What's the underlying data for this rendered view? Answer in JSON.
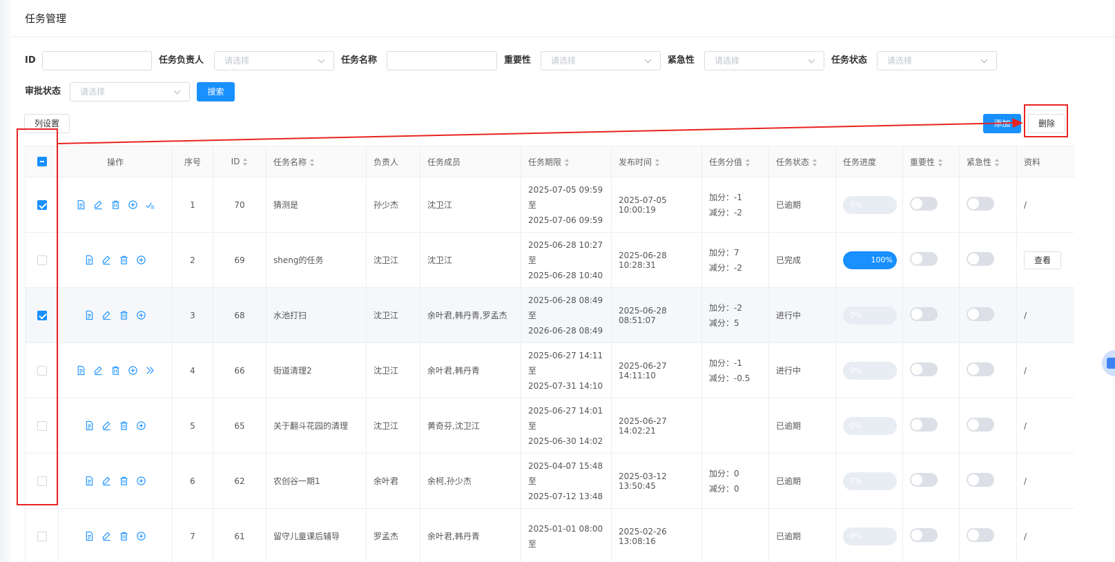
{
  "header": {
    "title": "任务管理"
  },
  "filters": {
    "id_label": "ID",
    "owner_label": "任务负责人",
    "owner_placeholder": "请选择",
    "name_label": "任务名称",
    "importance_label": "重要性",
    "importance_placeholder": "请选择",
    "urgency_label": "紧急性",
    "urgency_placeholder": "请选择",
    "status_label": "任务状态",
    "status_placeholder": "请选择",
    "approval_label": "审批状态",
    "approval_placeholder": "请选择",
    "search_button": "搜索"
  },
  "toolbar": {
    "column_settings": "列设置",
    "add_button": "添加",
    "delete_button": "删除"
  },
  "table": {
    "columns": {
      "ops": "操作",
      "seq": "序号",
      "id": "ID",
      "name": "任务名称",
      "owner": "负责人",
      "members": "任务成员",
      "deadline": "任务期限",
      "publish": "发布时间",
      "score": "任务分值",
      "status": "任务状态",
      "progress": "任务进度",
      "importance": "重要性",
      "urgency": "紧急性",
      "material": "资料"
    },
    "to_label": "至",
    "rows": [
      {
        "checked": true,
        "seq": "1",
        "id": "70",
        "name": "猜测是",
        "owner": "孙少杰",
        "members": "沈卫江",
        "start": "2025-07-05 09:59",
        "end": "2025-07-06 09:59",
        "publish": "2025-07-05 10:00:19",
        "plus": "加分：-1",
        "minus": "减分：-2",
        "status": "已逾期",
        "progress_pct": 0,
        "progress_text": "0%",
        "material": "/",
        "extra_icon": "approve-icon"
      },
      {
        "checked": false,
        "seq": "2",
        "id": "69",
        "name": "sheng的任务",
        "owner": "沈卫江",
        "members": "沈卫江",
        "start": "2025-06-28 10:27",
        "end": "2025-06-28 10:40",
        "publish": "2025-06-28 10:28:31",
        "plus": "加分：7",
        "minus": "减分：-2",
        "status": "已完成",
        "progress_pct": 100,
        "progress_text": "100%",
        "material": "查看",
        "extra_icon": ""
      },
      {
        "checked": true,
        "seq": "3",
        "id": "68",
        "name": "水池打扫",
        "owner": "沈卫江",
        "members": "余叶君,韩丹青,罗孟杰",
        "start": "2025-06-28 08:49",
        "end": "2026-06-28 08:49",
        "publish": "2025-06-28 08:51:07",
        "plus": "加分：-2",
        "minus": "减分：5",
        "status": "进行中",
        "progress_pct": 0,
        "progress_text": "0%",
        "material": "/",
        "extra_icon": ""
      },
      {
        "checked": false,
        "seq": "4",
        "id": "66",
        "name": "街道清理2",
        "owner": "沈卫江",
        "members": "余叶君,韩丹青",
        "start": "2025-06-27 14:11",
        "end": "2025-07-31 14:10",
        "publish": "2025-06-27 14:11:10",
        "plus": "加分：-1",
        "minus": "减分：-0.5",
        "status": "进行中",
        "progress_pct": 0,
        "progress_text": "0%",
        "material": "/",
        "extra_icon": "forward-icon"
      },
      {
        "checked": false,
        "seq": "5",
        "id": "65",
        "name": "关于翻斗花园的清理",
        "owner": "沈卫江",
        "members": "黄奇芬,沈卫江",
        "start": "2025-06-27 14:01",
        "end": "2025-06-30 14:02",
        "publish": "2025-06-27 14:02:21",
        "plus": "",
        "minus": "",
        "status": "已逾期",
        "progress_pct": 0,
        "progress_text": "0%",
        "material": "/",
        "extra_icon": ""
      },
      {
        "checked": false,
        "seq": "6",
        "id": "62",
        "name": "农创谷一期1",
        "owner": "余叶君",
        "members": "余柯,孙少杰",
        "start": "2025-04-07 15:48",
        "end": "2025-07-12 13:48",
        "publish": "2025-03-12 13:50:45",
        "plus": "加分：0",
        "minus": "减分：0",
        "status": "已逾期",
        "progress_pct": 0,
        "progress_text": "0%",
        "material": "/",
        "extra_icon": ""
      },
      {
        "checked": false,
        "seq": "7",
        "id": "61",
        "name": "留守儿童课后辅导",
        "owner": "罗孟杰",
        "members": "余叶君,韩丹青",
        "start": "2025-01-01 08:00",
        "end": "",
        "publish": "2025-02-26 13:08:16",
        "plus": "",
        "minus": "",
        "status": "已逾期",
        "progress_pct": 0,
        "progress_text": "0%",
        "material": "/",
        "extra_icon": ""
      }
    ]
  },
  "colors": {
    "primary": "#1890ff",
    "annotation": "#e8231f"
  }
}
